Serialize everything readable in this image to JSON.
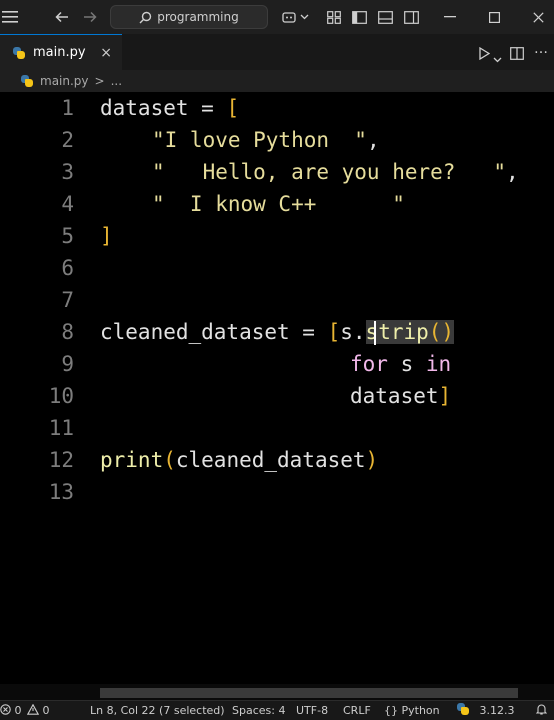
{
  "titlebar": {
    "search_text": "programming",
    "icons": [
      "menu-icon",
      "arrow-left-icon",
      "arrow-right-icon",
      "search-icon",
      "copilot-icon",
      "chevron-down-icon",
      "layout-icon",
      "toggle-sidebar-icon",
      "toggle-panel-icon",
      "toggle-secondary-sidebar-icon",
      "minimize-icon",
      "maximize-icon",
      "close-icon"
    ]
  },
  "tab": {
    "filename": "main.py",
    "close_glyph": "×"
  },
  "breadcrumb": {
    "file": "main.py",
    "separator": ">",
    "rest": "..."
  },
  "editor": {
    "lines": [
      {
        "n": "1"
      },
      {
        "n": "2"
      },
      {
        "n": "3"
      },
      {
        "n": "4"
      },
      {
        "n": "5"
      },
      {
        "n": "6"
      },
      {
        "n": "7"
      },
      {
        "n": "8"
      },
      {
        "n": "9"
      },
      {
        "n": "10"
      },
      {
        "n": "11"
      },
      {
        "n": "12"
      },
      {
        "n": "13"
      }
    ],
    "tokens": {
      "l1_ident": "dataset",
      "l1_op": " = ",
      "l1_br": "[",
      "l2_str": "\"I love Python  \"",
      "l2_op": ",",
      "l3_str": "\"   Hello, are you here?   \"",
      "l3_op": ",",
      "l4_str": "\"  I know C++      \"",
      "l5_br": "]",
      "l8_ident": "cleaned_dataset",
      "l8_op": " = ",
      "l8_br": "[",
      "l8_s": "s.",
      "l8_fn": "strip",
      "l8_paren": "()",
      "l9_kw1": "for",
      "l9_mid": " s ",
      "l9_kw2": "in",
      "l10_ident": "dataset",
      "l10_br": "]",
      "l12_fn": "print",
      "l12_p1": "(",
      "l12_arg": "cleaned_dataset",
      "l12_p2": ")"
    }
  },
  "statusbar": {
    "errors": "0",
    "warnings": "0",
    "position": "Ln 8, Col 22 (7 selected)",
    "spaces": "Spaces: 4",
    "encoding": "UTF-8",
    "eol": "CRLF",
    "language_brace": "{}",
    "language": "Python",
    "version": "3.12.3",
    "colors": {
      "accent": "#0078d4",
      "bracket": "#e8b533",
      "string": "#e6dd9c",
      "keyword": "#f2b8ea"
    }
  }
}
